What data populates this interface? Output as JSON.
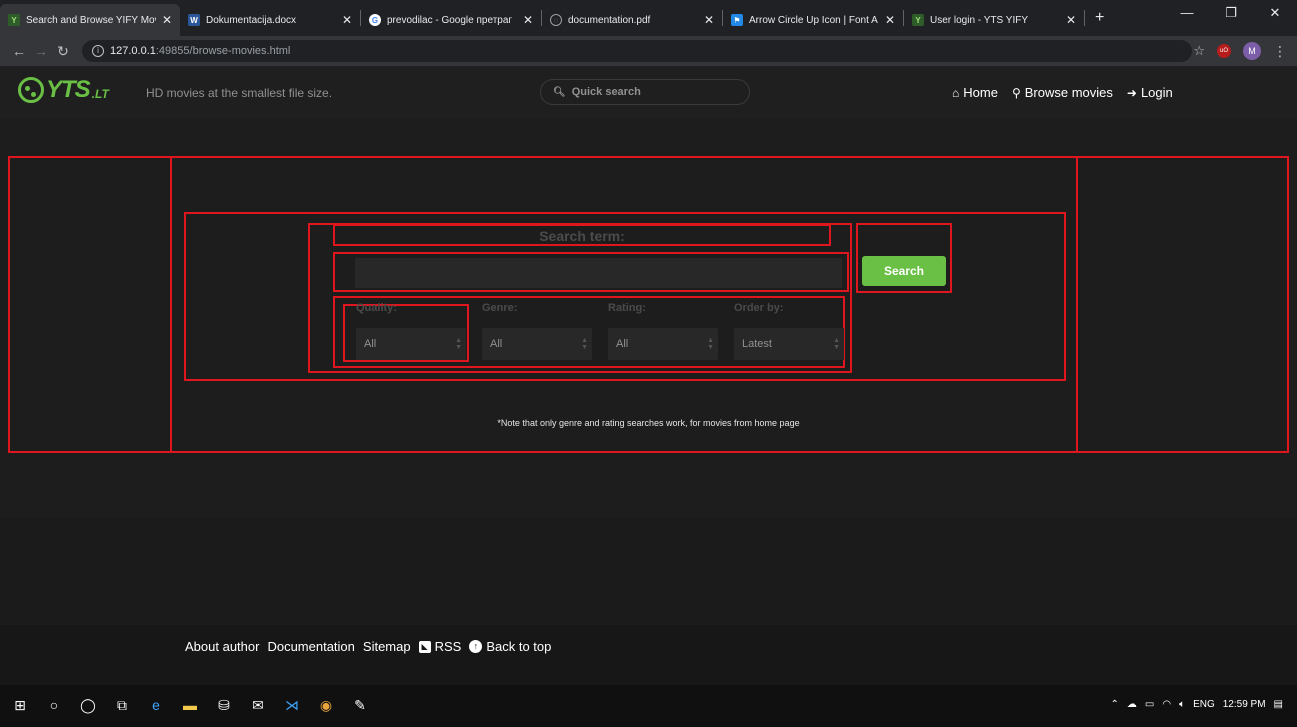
{
  "browser": {
    "tabs": [
      {
        "label": "Search and Browse YIFY Mov",
        "favicon": "yts-favicon",
        "active": true
      },
      {
        "label": "Dokumentacija.docx",
        "favicon": "word-favicon",
        "active": false
      },
      {
        "label": "prevodilac - Google претраг",
        "favicon": "google-favicon",
        "active": false
      },
      {
        "label": "documentation.pdf",
        "favicon": "globe-favicon",
        "active": false
      },
      {
        "label": "Arrow Circle Up Icon | Font A",
        "favicon": "fontawesome-favicon",
        "active": false
      },
      {
        "label": "User login - YTS YIFY",
        "favicon": "yts-favicon",
        "active": false
      }
    ],
    "url_host": "127.0.0.1",
    "url_rest": ":49855/browse-movies.html",
    "profile_initial": "M",
    "extension_label": "uO"
  },
  "header": {
    "logo_text": "YTS",
    "logo_suffix": ".LT",
    "tagline": "HD movies at the smallest file size.",
    "quick_search_placeholder": "Quick search",
    "nav": {
      "home": "Home",
      "browse": "Browse movies",
      "login": "Login"
    }
  },
  "search": {
    "label": "Search term:",
    "input_value": "",
    "button_label": "Search",
    "filters": [
      {
        "label": "Quality:",
        "value": "All"
      },
      {
        "label": "Genre:",
        "value": "All"
      },
      {
        "label": "Rating:",
        "value": "All"
      },
      {
        "label": "Order by:",
        "value": "Latest"
      }
    ],
    "note": "*Note that only genre and rating searches work, for movies from home page"
  },
  "footer": {
    "about": "About author",
    "documentation": "Documentation",
    "sitemap": "Sitemap",
    "rss": "RSS",
    "back_to_top": "Back to top"
  },
  "taskbar": {
    "language": "ENG",
    "time": "12:59 PM"
  },
  "colors": {
    "accent": "#6ac045",
    "annotation_border": "#e0161e",
    "background": "#1d1d1d"
  }
}
